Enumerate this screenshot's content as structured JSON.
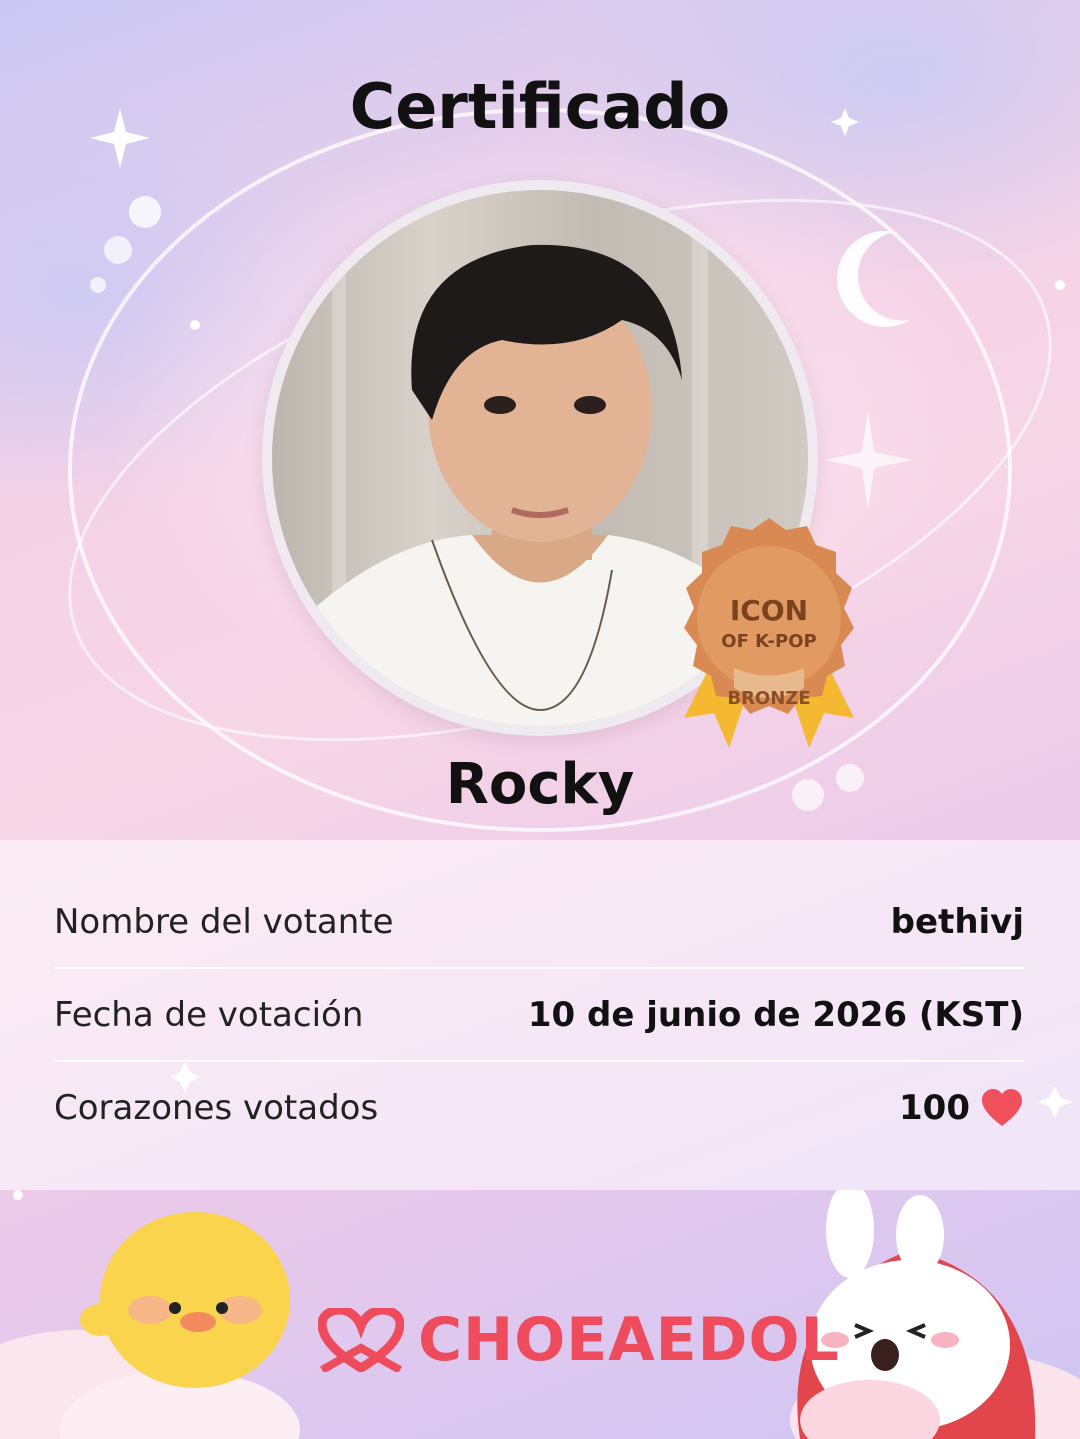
{
  "header": {
    "title": "Certificado"
  },
  "idol": {
    "name": "Rocky"
  },
  "badge": {
    "line1": "ICON",
    "line2": "OF K-POP",
    "tier": "BRONZE"
  },
  "info": {
    "rows": [
      {
        "label": "Nombre del votante",
        "value": "bethivj"
      },
      {
        "label": "Fecha de votación",
        "value": "10 de junio de 2026 (KST)"
      },
      {
        "label": "Corazones votados",
        "value": "100"
      }
    ]
  },
  "brand": {
    "name": "CHOEAEDOL"
  },
  "colors": {
    "brand": "#ee4b5c",
    "badge": "#d88a52",
    "heart": "#f0505c"
  }
}
